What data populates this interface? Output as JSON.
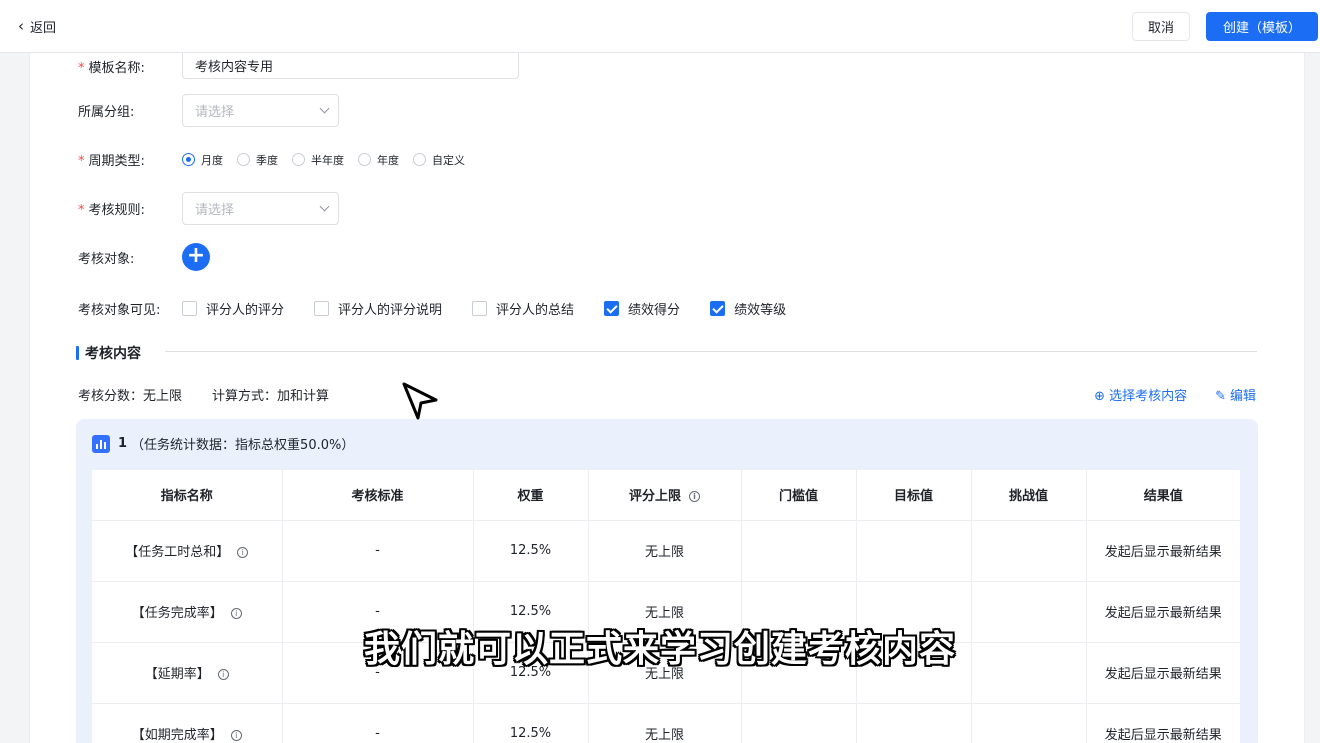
{
  "header": {
    "back_label": "返回",
    "cancel_label": "取消",
    "create_label": "创建（模板）"
  },
  "form": {
    "name": {
      "label": "模板名称:",
      "value": "考核内容专用"
    },
    "group": {
      "label": "所属分组:",
      "placeholder": "请选择"
    },
    "cycle": {
      "label": "周期类型:",
      "options": [
        "月度",
        "季度",
        "半年度",
        "年度",
        "自定义"
      ],
      "selected": "月度"
    },
    "rule": {
      "label": "考核规则:",
      "placeholder": "请选择"
    },
    "target": {
      "label": "考核对象:"
    },
    "visible": {
      "label": "考核对象可见:",
      "options": [
        {
          "label": "评分人的评分",
          "checked": false
        },
        {
          "label": "评分人的评分说明",
          "checked": false
        },
        {
          "label": "评分人的总结",
          "checked": false
        },
        {
          "label": "绩效得分",
          "checked": true
        },
        {
          "label": "绩效等级",
          "checked": true
        }
      ]
    }
  },
  "section": {
    "title": "考核内容",
    "score_text": "考核分数：无上限",
    "calc_text": "计算方式：加和计算",
    "select_label": "选择考核内容",
    "edit_label": "编辑"
  },
  "group": {
    "index": "1",
    "desc": "（任务统计数据：指标总权重50.0%）",
    "columns": [
      "指标名称",
      "考核标准",
      "权重",
      "评分上限",
      "门槛值",
      "目标值",
      "挑战值",
      "结果值"
    ],
    "rows": [
      {
        "name": "【任务工时总和】",
        "standard": "-",
        "weight": "12.5%",
        "limit": "无上限",
        "threshold": "",
        "target": "",
        "challenge": "",
        "result": "发起后显示最新结果"
      },
      {
        "name": "【任务完成率】",
        "standard": "-",
        "weight": "12.5%",
        "limit": "无上限",
        "threshold": "",
        "target": "",
        "challenge": "",
        "result": "发起后显示最新结果"
      },
      {
        "name": "【延期率】",
        "standard": "-",
        "weight": "12.5%",
        "limit": "无上限",
        "threshold": "",
        "target": "",
        "challenge": "",
        "result": "发起后显示最新结果"
      },
      {
        "name": "【如期完成率】",
        "standard": "-",
        "weight": "12.5%",
        "limit": "无上限",
        "threshold": "",
        "target": "",
        "challenge": "",
        "result": "发起后显示最新结果"
      }
    ]
  },
  "subtitle": "我们就可以正式来学习创建考核内容",
  "colors": {
    "primary": "#1b6ef3",
    "required": "#f54a45",
    "group_bg": "#eaf1fd"
  }
}
